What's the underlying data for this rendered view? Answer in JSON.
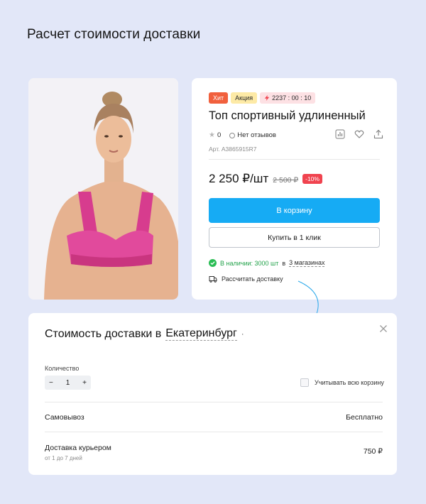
{
  "page": {
    "title": "Расчет стоимости доставки"
  },
  "product": {
    "badges": {
      "hit": "Хит",
      "promo": "Акция",
      "timer": "2237 : 00 : 10"
    },
    "name": "Топ спортивный удлиненный",
    "rating": "0",
    "reviews": "Нет отзывов",
    "sku": "Арт. A3865915R7",
    "price": "2 250 ₽/шт",
    "old_price": "2 500 ₽",
    "discount": "-10%",
    "cart_button": "В корзину",
    "oneclick_button": "Купить в 1 клик",
    "stock": {
      "available": "В наличии: 3000 шт",
      "in": "в",
      "stores": "3 магазинах"
    },
    "delivery_link": "Рассчитать доставку",
    "action_icons": [
      "compare-icon",
      "heart-icon",
      "share-icon"
    ]
  },
  "modal": {
    "title": "Стоимость доставки в",
    "city": "Екатеринбург",
    "qty_label": "Количество",
    "qty_value": "1",
    "qty_minus": "−",
    "qty_plus": "+",
    "cart_checkbox": "Учитывать всю корзину",
    "options": [
      {
        "label": "Самовывоз",
        "sub": "",
        "value": "Бесплатно"
      },
      {
        "label": "Доставка курьером",
        "sub": "от 1 до 7 дней",
        "value": "750 ₽"
      }
    ]
  },
  "colors": {
    "background": "#e2e7f8",
    "accent": "#16abf4",
    "badge_hit": "#f1603d",
    "discount": "#f0434f",
    "in_stock": "#2bbd55"
  }
}
